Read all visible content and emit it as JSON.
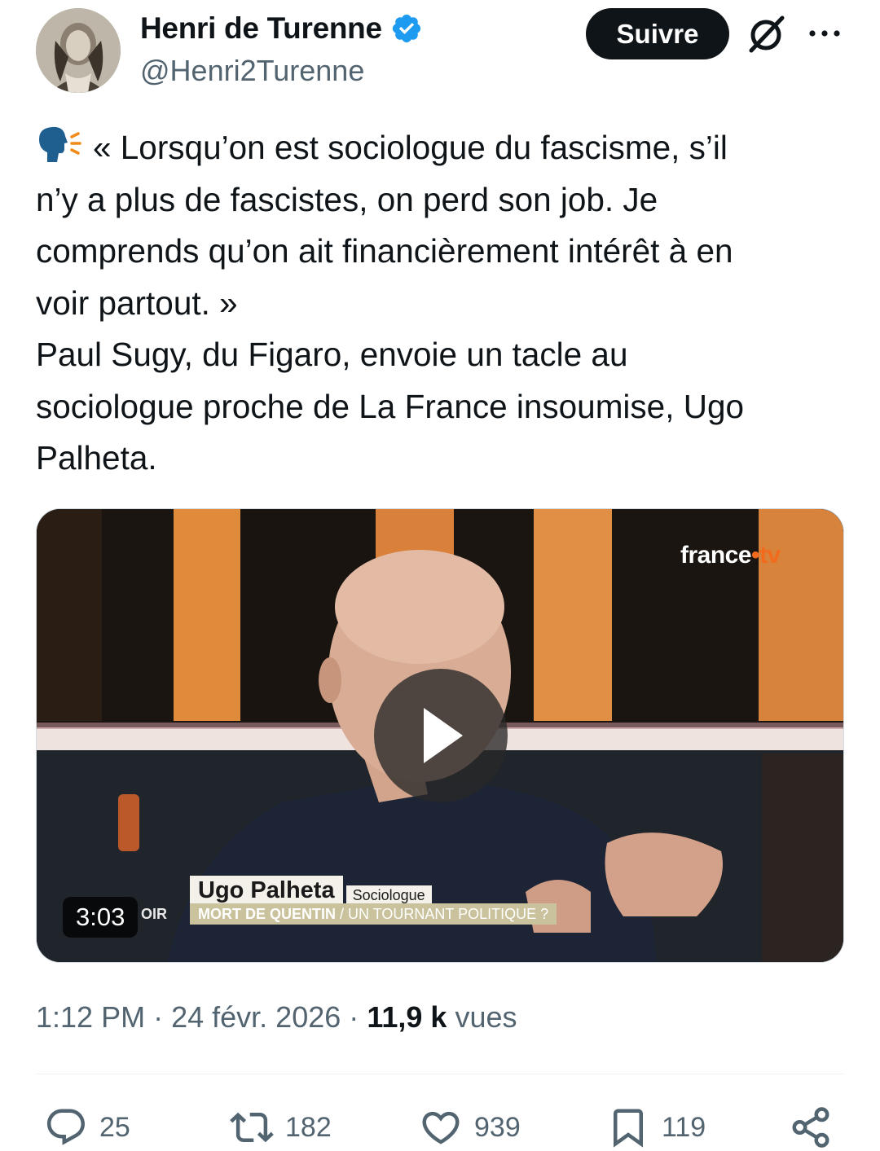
{
  "author": {
    "name": "Henri de Turenne",
    "handle": "@Henri2Turenne",
    "verified": true,
    "avatar_icon": "portrait-avatar"
  },
  "header": {
    "follow_label": "Suivre",
    "grok_icon": "grok-icon",
    "more_icon": "more-icon"
  },
  "tweet": {
    "emoji_icon": "speaking-head-icon",
    "lines": [
      "« Lorsqu’on est sociologue du fascisme, s’il",
      "n’y a plus de fascistes, on perd son job. Je",
      "comprends qu’on ait financièrement intérêt à en",
      "voir partout. »",
      "Paul Sugy, du Figaro, envoie un tacle au",
      "sociologue proche de La France insoumise, Ugo",
      "Palheta."
    ]
  },
  "video": {
    "brand_main": "france",
    "brand_dot": "•",
    "brand_suffix": "tv",
    "lower_third_name": "Ugo Palheta",
    "lower_third_role": "Sociologue",
    "lower_third_prefix": "OIR",
    "lower_third_headline": "MORT DE QUENTIN",
    "lower_third_separator": "/",
    "lower_third_subheadline": "UN TOURNANT POLITIQUE ?",
    "duration": "3:03",
    "play_icon": "play-icon"
  },
  "meta": {
    "time": "1:12 PM",
    "separator": "·",
    "date": "24 févr. 2026",
    "views_count": "11,9 k",
    "views_label": "vues"
  },
  "actions": {
    "replies": "25",
    "retweets": "182",
    "likes": "939",
    "bookmarks": "119"
  },
  "colors": {
    "text": "#0f1419",
    "secondary": "#536471",
    "verified": "#1d9bf0",
    "follow_bg": "#0f1419",
    "brand_accent": "#f26b1d"
  }
}
